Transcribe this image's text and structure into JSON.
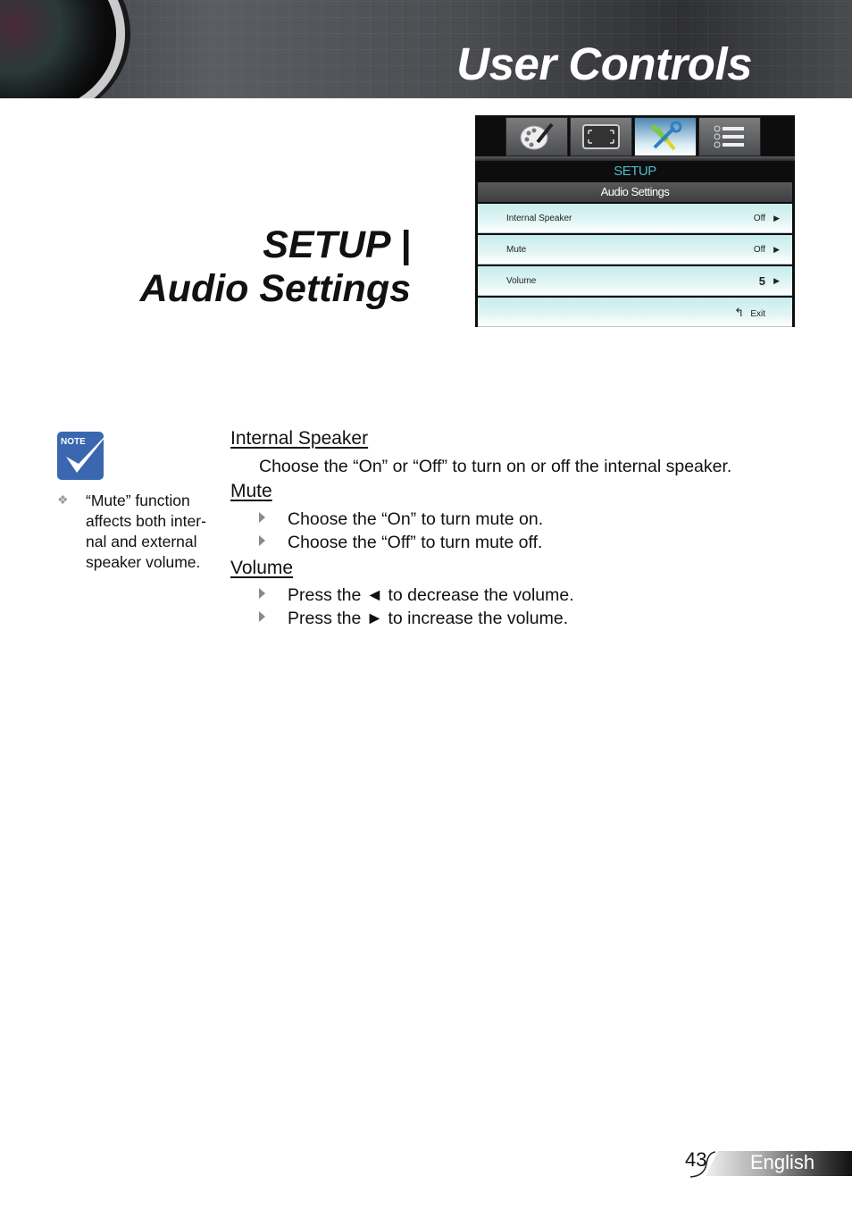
{
  "header": {
    "title": "User Controls"
  },
  "section": {
    "title_line1": "SETUP |",
    "title_line2": "Audio Settings"
  },
  "osd": {
    "tabs": [
      {
        "icon": "palette-icon",
        "active": false
      },
      {
        "icon": "display-frame-icon",
        "active": false
      },
      {
        "icon": "tools-icon",
        "active": true
      },
      {
        "icon": "list-icon",
        "active": false
      }
    ],
    "heading": "SETUP",
    "subheading": "Audio Settings",
    "rows": [
      {
        "label": "Internal Speaker",
        "value": "Off",
        "arrow": "▶"
      },
      {
        "label": "Mute",
        "value": "Off",
        "arrow": "▶"
      },
      {
        "label": "Volume",
        "value": "5",
        "arrow": "▶"
      }
    ],
    "exit_icon": "↰",
    "exit_label": "Exit",
    "accent_color": "#53b8c9"
  },
  "note": {
    "badge": "Note",
    "bullet": "❖",
    "text": "“Mute” function affects both inter- nal and external speaker volume."
  },
  "content": {
    "internal_speaker": {
      "heading": "Internal Speaker",
      "text": "Choose the “On” or “Off” to turn on or off the internal speaker."
    },
    "mute": {
      "heading": "Mute",
      "bullets": [
        "Choose the “On” to turn mute on.",
        "Choose the “Off” to turn mute off."
      ]
    },
    "volume": {
      "heading": "Volume",
      "bullets": [
        "Press the ◄ to decrease the volume.",
        "Press the ► to increase the volume."
      ]
    }
  },
  "footer": {
    "page_number": "43",
    "language": "English"
  }
}
